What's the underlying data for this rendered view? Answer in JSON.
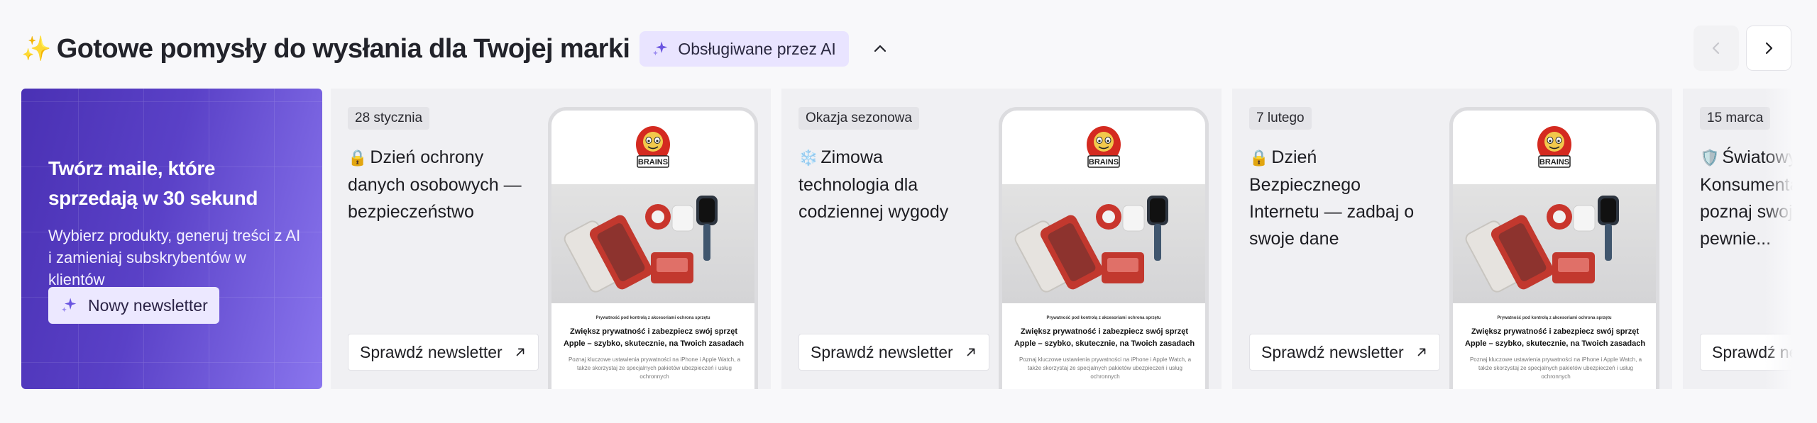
{
  "header": {
    "title": "Gotowe pomysły do wysłania dla Twojej marki",
    "spark_icon": "sparkles-emoji",
    "ai_badge": "Obsługiwane przez AI"
  },
  "promo": {
    "title": "Twórz maile, które sprzedają w 30 sekund",
    "description": "Wybierz produkty, generuj treści z AI i zamieniaj subskrybentów w klientów",
    "button": "Nowy newsletter"
  },
  "cards": [
    {
      "tag": "28 stycznia",
      "emoji": "🔒",
      "title": "Dzień ochrony danych osobowych — bezpieczeństwo",
      "button": "Sprawdź newsletter",
      "preview": {
        "logo": "BRAINS",
        "small": "Prywatność pod kontrolą z akcesoriami ochrona sprzętu",
        "heading": "Zwiększ prywatność i zabezpiecz swój sprzęt Apple – szybko, skutecznie, na Twoich zasadach",
        "text": "Poznaj kluczowe ustawienia prywatności na iPhone i Apple Watch, a także skorzystaj ze specjalnych pakietów ubezpieczeń i usług ochronnych"
      }
    },
    {
      "tag": "Okazja sezonowa",
      "emoji": "❄️",
      "title": "Zimowa technologia dla codziennej wygody",
      "button": "Sprawdź newsletter",
      "preview": {
        "logo": "BRAINS",
        "small": "Prywatność pod kontrolą z akcesoriami ochrona sprzętu",
        "heading": "Zwiększ prywatność i zabezpiecz swój sprzęt Apple – szybko, skutecznie, na Twoich zasadach",
        "text": "Poznaj kluczowe ustawienia prywatności na iPhone i Apple Watch, a także skorzystaj ze specjalnych pakietów ubezpieczeń i usług ochronnych"
      }
    },
    {
      "tag": "7 lutego",
      "emoji": "🔒",
      "title": "Dzień Bezpiecznego Internetu — zadbaj o swoje dane",
      "button": "Sprawdź newsletter",
      "preview": {
        "logo": "BRAINS",
        "small": "Prywatność pod kontrolą z akcesoriami ochrona sprzętu",
        "heading": "Zwiększ prywatność i zabezpiecz swój sprzęt Apple – szybko, skutecznie, na Twoich zasadach",
        "text": "Poznaj kluczowe ustawienia prywatności na iPhone i Apple Watch, a także skorzystaj ze specjalnych pakietów ubezpieczeń i usług ochronnych"
      }
    },
    {
      "tag": "15 marca",
      "emoji": "🛡️",
      "title": "Światowy Dzień Konsumenta — poznaj swoje prawa i pewnie...",
      "button": "Sprawdź newsletter"
    }
  ],
  "colors": {
    "accent": "#5a41c7",
    "badge_bg": "#e9e4ff",
    "logo_red": "#d42a20"
  },
  "icons": {
    "ai": "sparkle-icon",
    "collapse": "chevron-up-icon",
    "prev": "chevron-left-icon",
    "next": "chevron-right-icon",
    "card_button": "arrow-up-right-icon"
  }
}
